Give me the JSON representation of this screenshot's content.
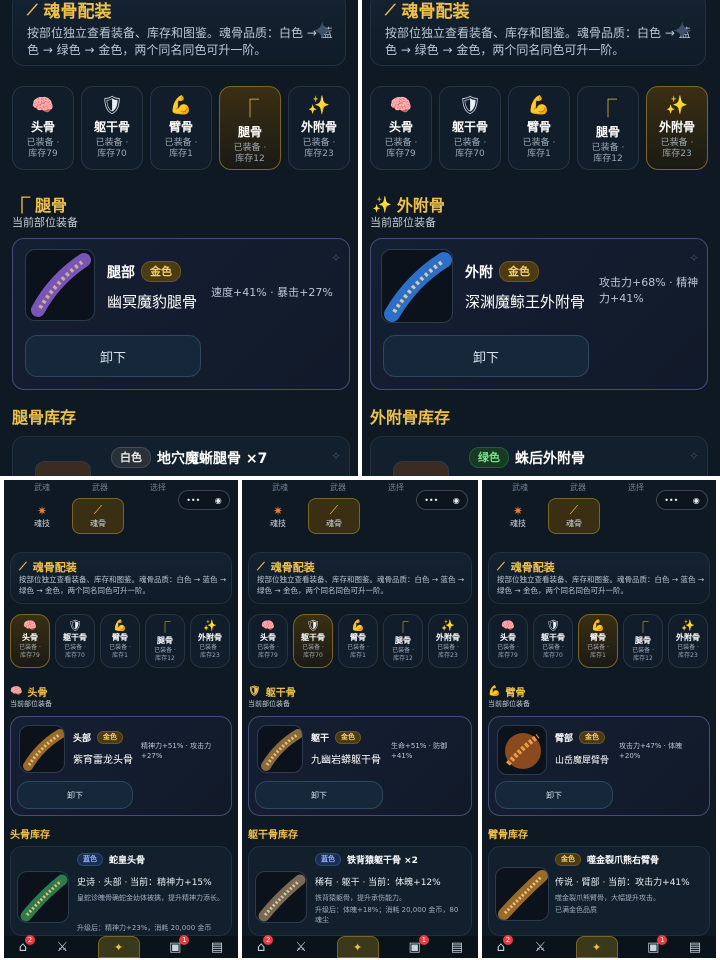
{
  "header": {
    "title": "魂骨配装",
    "desc": "按部位独立查看装备、库存和图鉴。魂骨品质：白色 → 蓝色 → 绿色 → 金色，两个同名同色可升一阶。"
  },
  "tabs": [
    {
      "key": "head",
      "label": "头骨",
      "sub1": "已装备 ·",
      "sub2": "库存79",
      "icon": "brain-icon"
    },
    {
      "key": "torso",
      "label": "躯干骨",
      "sub1": "已装备 ·",
      "sub2": "库存70",
      "icon": "shield-icon"
    },
    {
      "key": "arm",
      "label": "臂骨",
      "sub1": "已装备 ·",
      "sub2": "库存1",
      "icon": "flexed-arm-icon"
    },
    {
      "key": "leg",
      "label": "腿骨",
      "sub1": "已装备 ·",
      "sub2": "库存12",
      "icon": "leg-icon"
    },
    {
      "key": "ext",
      "label": "外附骨",
      "sub1": "已装备 ·",
      "sub2": "库存23",
      "icon": "sparkles-icon"
    }
  ],
  "current_equip_label": "当前部位装备",
  "unequip_label": "卸下",
  "panels": {
    "leg": {
      "section": "腿骨",
      "slot": "腿部",
      "quality": "金色",
      "name": "幽冥魔豹腿骨",
      "stats": "速度+41% · 暴击+27%",
      "inv_title": "腿骨库存",
      "inv": {
        "quality": "白色",
        "name": "地穴魔蜥腿骨 ×7"
      }
    },
    "ext": {
      "section": "外附骨",
      "slot": "外附",
      "quality": "金色",
      "name": "深渊魔鲸王外附骨",
      "stats": "攻击力+68% · 精神力+41%",
      "inv_title": "外附骨库存",
      "inv": {
        "quality": "绿色",
        "name": "蛛后外附骨"
      }
    },
    "head": {
      "section": "头骨",
      "slot": "头部",
      "quality": "金色",
      "name": "紫宵雷龙头骨",
      "stats": "精神力+51% · 攻击力+27%",
      "inv_title": "头骨库存",
      "inv": {
        "quality": "蓝色",
        "name": "蛇皇头骨",
        "line": "史诗 · 头部 · 当前：精神力+15%",
        "desc": "皇蛇诊魄骨确蛇金幼体被擒，提升精神力添长。",
        "upgrade": "升级后：精神力+23%，消耗 20,000 金币"
      }
    },
    "torso": {
      "section": "躯干骨",
      "slot": "躯干",
      "quality": "金色",
      "name": "九幽岩蟒躯干骨",
      "stats": "生命+51% · 防御+41%",
      "inv_title": "躯干骨库存",
      "inv": {
        "quality": "蓝色",
        "name": "铁背猿躯干骨 ×2",
        "line": "稀有 · 躯干 · 当前：体魄+12%",
        "desc": "铁背猿躯骨，提升承伤能力。",
        "upgrade": "升级后：体魄+18%；消耗 20,000 金币，80 魂尘"
      }
    },
    "arm": {
      "section": "臂骨",
      "slot": "臂部",
      "quality": "金色",
      "name": "山岳魔犀臂骨",
      "stats": "攻击力+47% · 体魄+20%",
      "inv_title": "臂骨库存",
      "inv": {
        "quality": "金色",
        "name": "噬金裂爪熊右臂骨",
        "line": "传说 · 臂部 · 当前：攻击力+41%",
        "desc": "噬金裂爪熊臂骨，大幅提升攻击。",
        "upgrade": "已满金色品质"
      }
    }
  },
  "top_nav": {
    "items": [
      "武魂",
      "武器",
      "选择"
    ],
    "left_tab": "魂技",
    "right_tab": "魂骨"
  },
  "bottom_badges": {
    "home": "2",
    "bag": "1"
  },
  "colors": {
    "bg": "#0e1924",
    "gold": "#f0c14b",
    "accent_border": "#7a6522"
  }
}
